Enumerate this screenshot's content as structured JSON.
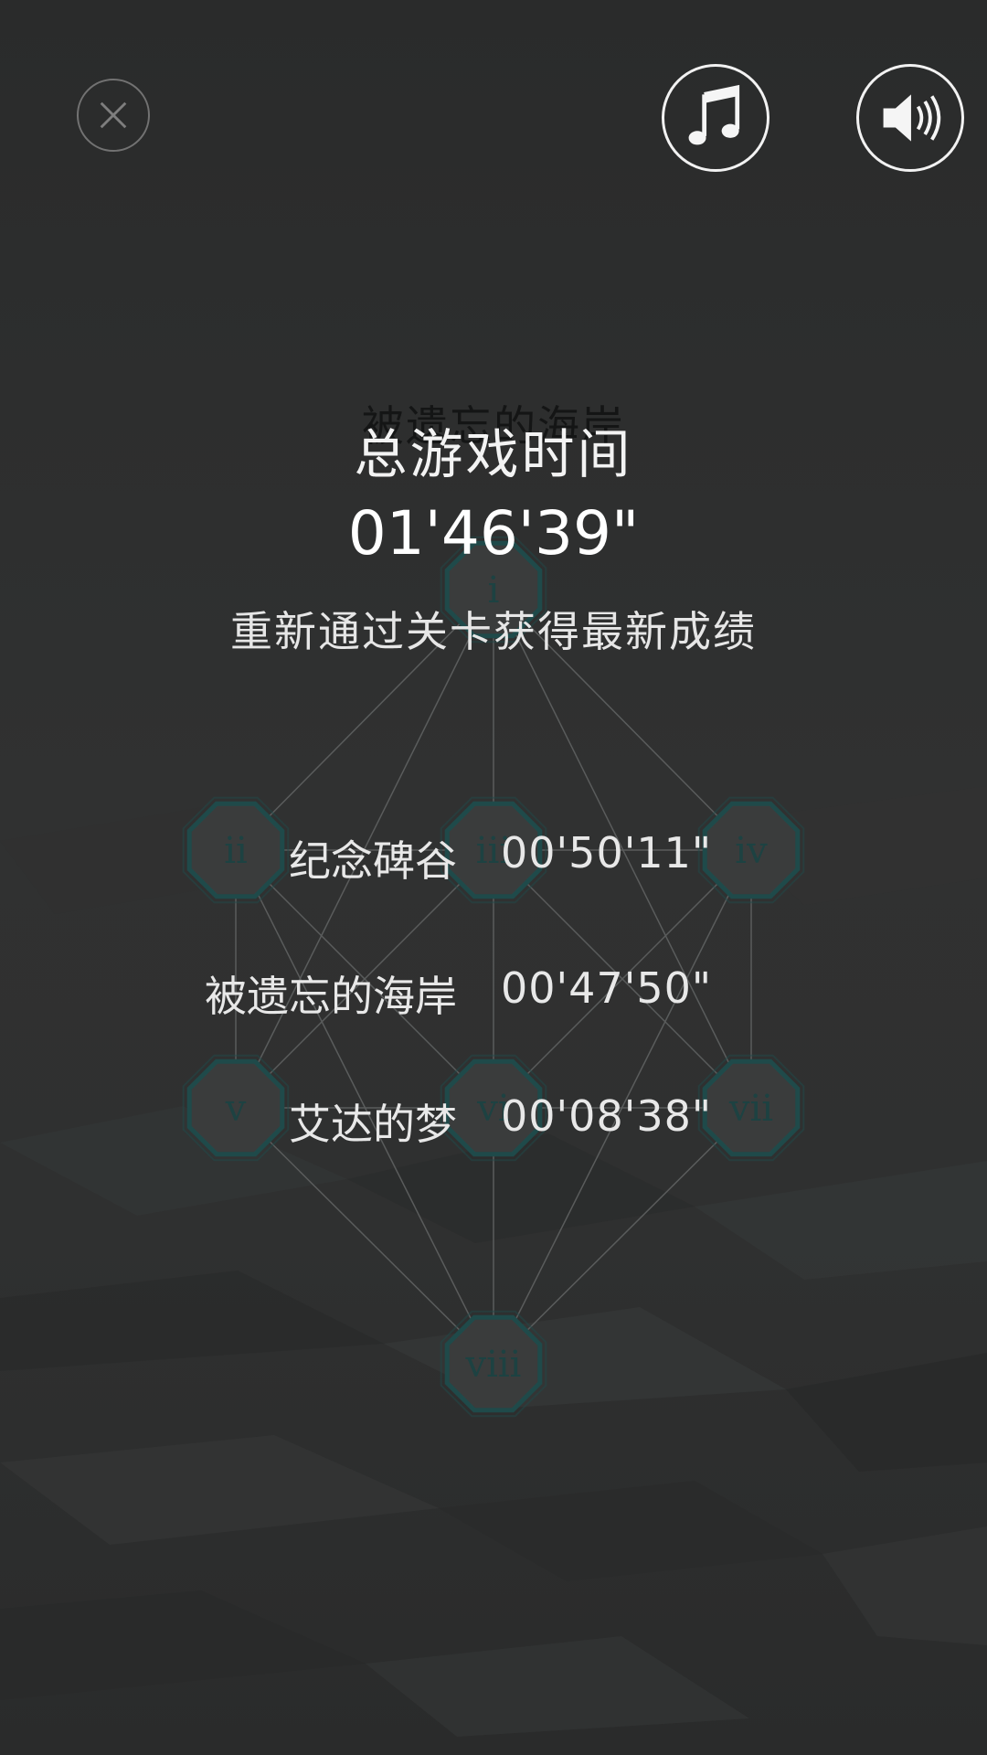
{
  "colors": {
    "node_fill": "#3a3c3c",
    "node_stroke": "#1f4a4a",
    "node_text": "#1d4242",
    "line": "#5a5c5c",
    "accent": "#1f4a4a"
  },
  "icons": {
    "close": "close-icon",
    "music": "music-note-icon",
    "sound": "speaker-volume-icon"
  },
  "stage": {
    "ghost_title": "被遗忘的海岸",
    "nodes": [
      "i",
      "ii",
      "iii",
      "iv",
      "v",
      "vi",
      "vii",
      "viii"
    ]
  },
  "results": {
    "total_label": "总游戏时间",
    "total_time": "01'46'39\"",
    "hint": "重新通过关卡获得最新成绩",
    "rows": [
      {
        "name": "纪念碑谷",
        "time": "00'50'11\""
      },
      {
        "name": "被遗忘的海岸",
        "time": "00'47'50\""
      },
      {
        "name": "艾达的梦",
        "time": "00'08'38\""
      }
    ]
  }
}
